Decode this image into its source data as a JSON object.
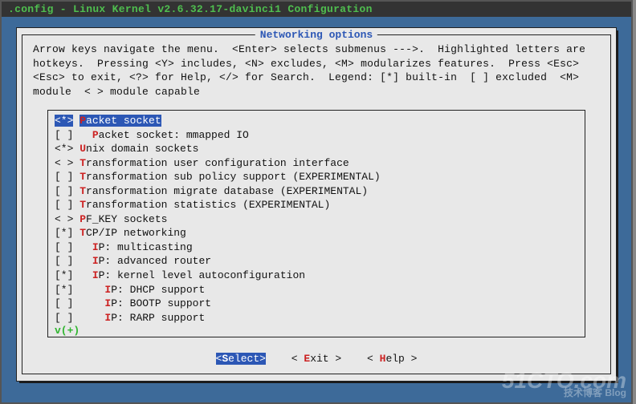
{
  "window": {
    "title": ".config - Linux Kernel v2.6.32.17-davinci1 Configuration"
  },
  "dialog": {
    "title": " Networking options ",
    "help": "Arrow keys navigate the menu.  <Enter> selects submenus --->.  Highlighted letters are hotkeys.  Pressing <Y> includes, <N> excludes, <M> modularizes features.  Press <Esc><Esc> to exit, <?> for Help, </> for Search.  Legend: [*] built-in  [ ] excluded  <M> module  < > module capable"
  },
  "menu": {
    "items": [
      {
        "ind": "<*>",
        "pre": " ",
        "hot": "P",
        "rest": "acket socket",
        "selected": true
      },
      {
        "ind": "[ ]",
        "pre": "   ",
        "hot": "P",
        "rest": "acket socket: mmapped IO"
      },
      {
        "ind": "<*>",
        "pre": " ",
        "hot": "U",
        "rest": "nix domain sockets"
      },
      {
        "ind": "< >",
        "pre": " ",
        "hot": "T",
        "rest": "ransformation user configuration interface"
      },
      {
        "ind": "[ ]",
        "pre": " ",
        "hot": "T",
        "rest": "ransformation sub policy support (EXPERIMENTAL)"
      },
      {
        "ind": "[ ]",
        "pre": " ",
        "hot": "T",
        "rest": "ransformation migrate database (EXPERIMENTAL)"
      },
      {
        "ind": "[ ]",
        "pre": " ",
        "hot": "T",
        "rest": "ransformation statistics (EXPERIMENTAL)"
      },
      {
        "ind": "< >",
        "pre": " ",
        "hot": "P",
        "rest": "F_KEY sockets"
      },
      {
        "ind": "[*]",
        "pre": " ",
        "hot": "T",
        "rest": "CP/IP networking"
      },
      {
        "ind": "[ ]",
        "pre": "   ",
        "hot": "I",
        "rest": "P: multicasting"
      },
      {
        "ind": "[ ]",
        "pre": "   ",
        "hot": "I",
        "rest": "P: advanced router"
      },
      {
        "ind": "[*]",
        "pre": "   ",
        "hot": "I",
        "rest": "P: kernel level autoconfiguration"
      },
      {
        "ind": "[*]",
        "pre": "     ",
        "hot": "I",
        "rest": "P: DHCP support"
      },
      {
        "ind": "[ ]",
        "pre": "     ",
        "hot": "I",
        "rest": "P: BOOTP support"
      },
      {
        "ind": "[ ]",
        "pre": "     ",
        "hot": "I",
        "rest": "P: RARP support"
      }
    ],
    "scroll_indicator": "v(+)"
  },
  "buttons": {
    "select": {
      "open": "<",
      "hot": "S",
      "rest": "elect>",
      "active": true
    },
    "exit": {
      "open": "< ",
      "hot": "E",
      "rest": "xit >"
    },
    "help": {
      "open": "< ",
      "hot": "H",
      "rest": "elp >"
    }
  },
  "watermark": {
    "main": "51CTO.com",
    "sub": "技术博客    Blog"
  }
}
